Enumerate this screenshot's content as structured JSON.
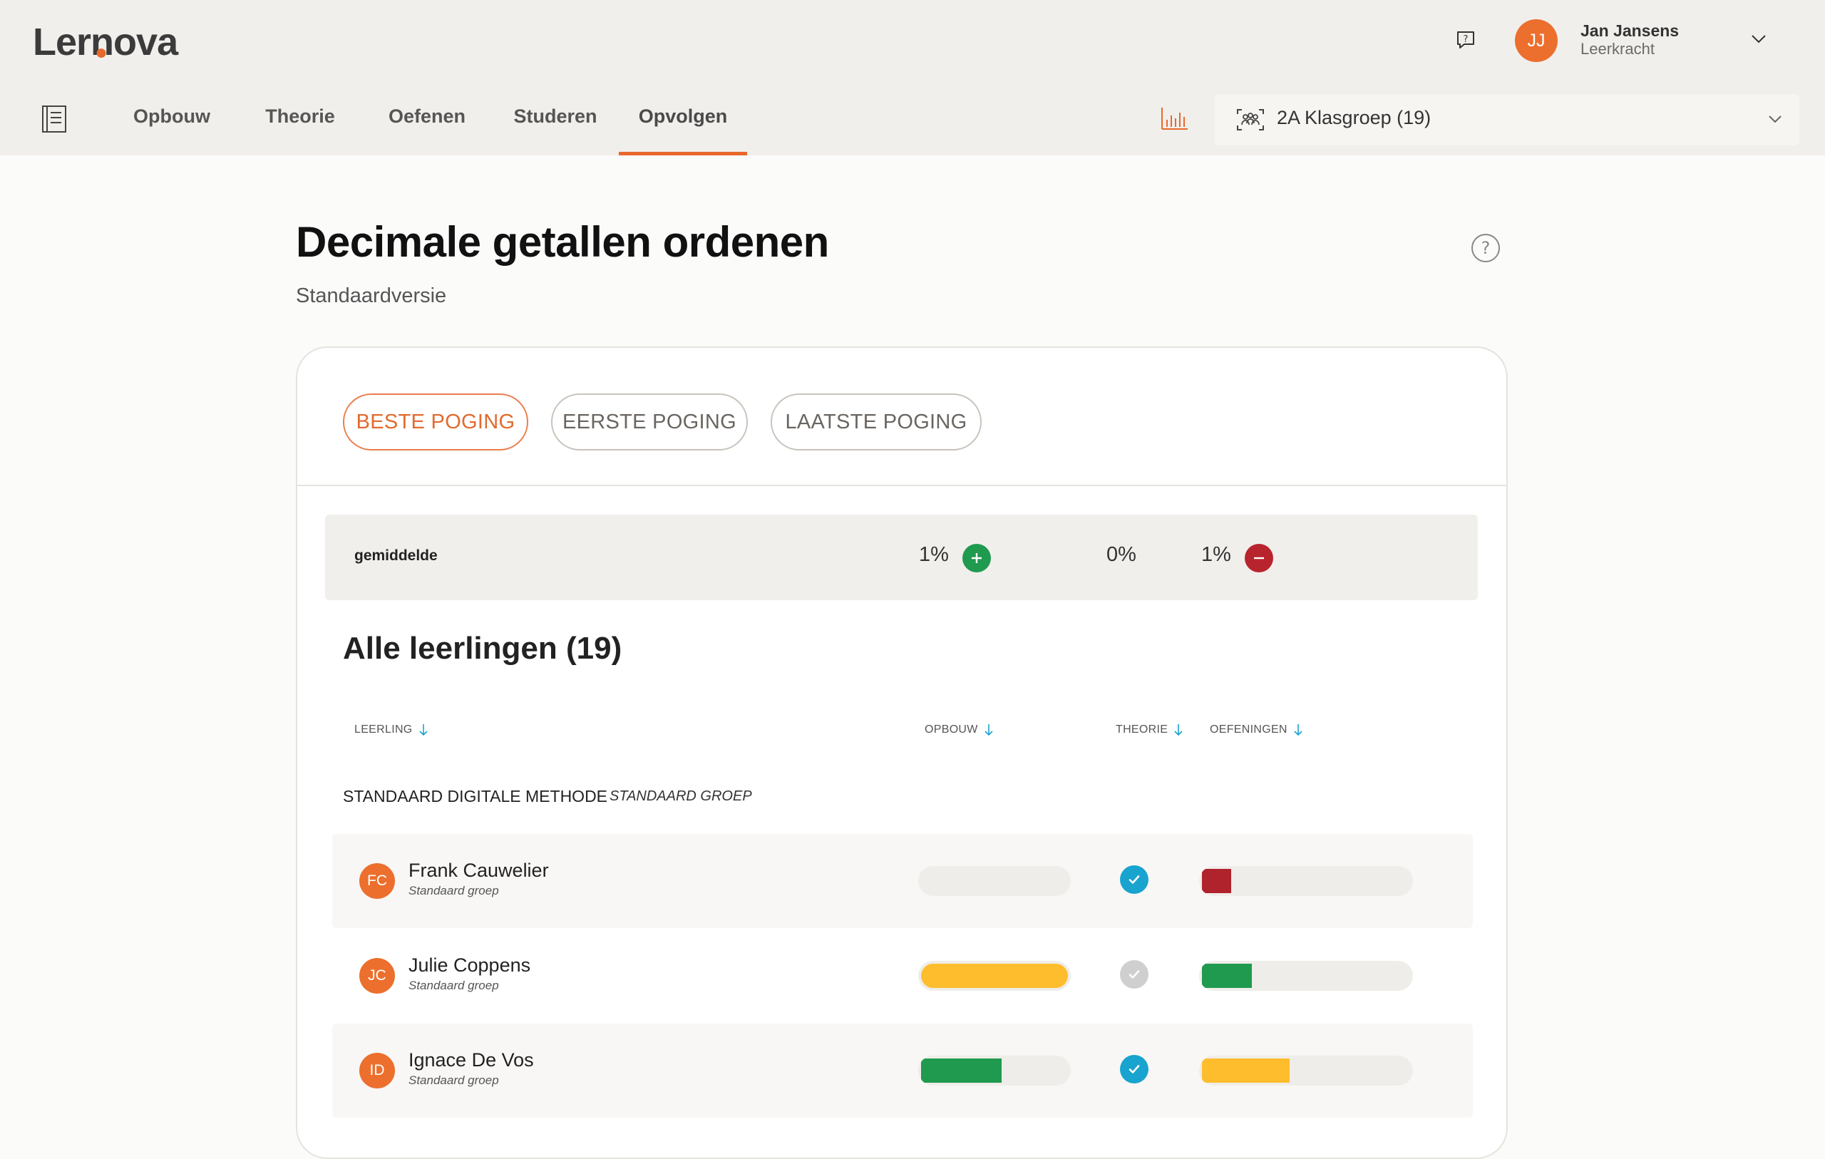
{
  "header": {
    "logo_text_a": "Ler",
    "logo_text_b": "n",
    "logo_text_c": "ova",
    "user": {
      "initials": "JJ",
      "name": "Jan Jansens",
      "role": "Leerkracht"
    },
    "nav": [
      {
        "label": "Opbouw"
      },
      {
        "label": "Theorie"
      },
      {
        "label": "Oefenen"
      },
      {
        "label": "Studeren"
      },
      {
        "label": "Opvolgen",
        "active": true
      }
    ],
    "group_select": {
      "value": "2A Klasgroep (19)"
    }
  },
  "page": {
    "title": "Decimale getallen ordenen",
    "subtitle": "Standaardversie"
  },
  "attempts": [
    {
      "label": "BESTE POGING",
      "active": true
    },
    {
      "label": "EERSTE POGING",
      "active": false
    },
    {
      "label": "LAATSTE POGING",
      "active": false
    }
  ],
  "average": {
    "label": "gemiddelde",
    "opbouw": "1%",
    "theorie": "0%",
    "oefeningen": "1%"
  },
  "list": {
    "title": "Alle leerlingen (19)",
    "columns": {
      "leerling": "LEERLING",
      "opbouw": "OPBOUW",
      "theorie": "THEORIE",
      "oefeningen": "OEFENINGEN"
    },
    "group_label": "STANDAARD DIGITALE METHODE",
    "group_sub": "STANDAARD GROEP",
    "students": [
      {
        "initials": "FC",
        "name": "Frank Cauwelier",
        "group": "Standaard groep",
        "opbouw": 0,
        "opbouw_color": "#fdbd2c",
        "theorie_done": true,
        "oefeningen": 0.14,
        "oefeningen_color": "#b0222c"
      },
      {
        "initials": "JC",
        "name": "Julie Coppens",
        "group": "Standaard groep",
        "opbouw": 1.0,
        "opbouw_color": "#fdbd2c",
        "theorie_done": false,
        "oefeningen": 0.24,
        "oefeningen_color": "#1f9a4f"
      },
      {
        "initials": "ID",
        "name": "Ignace De Vos",
        "group": "Standaard groep",
        "opbouw": 0.55,
        "opbouw_color": "#1f9a4f",
        "theorie_done": true,
        "oefeningen": 0.42,
        "oefeningen_color": "#fdbd2c"
      }
    ]
  },
  "colors": {
    "accent": "#e8692c",
    "check_done": "#19a3cf",
    "check_pending": "#cfcfcf"
  }
}
